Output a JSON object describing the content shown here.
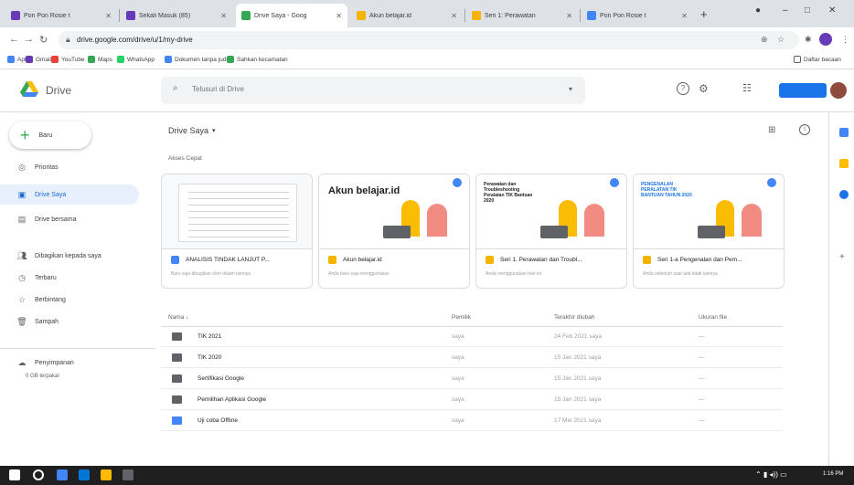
{
  "browser": {
    "tabs": [
      {
        "label": "Pon Pon Rosie t",
        "active": false,
        "color": "#673ab7"
      },
      {
        "label": "Sekali Masuk (85)",
        "active": false,
        "color": "#673ab7"
      },
      {
        "label": "Drive Saya - Goog",
        "active": true,
        "color": "#34a853"
      },
      {
        "label": "Akun belajar.id",
        "active": false,
        "color": "#f4b400"
      },
      {
        "label": "Seri 1: Perawatan",
        "active": false,
        "color": "#f4b400"
      },
      {
        "label": "Pon Pon Rosie t",
        "active": false,
        "color": "#4285f4"
      }
    ],
    "new_tab_label": "+",
    "url": "drive.google.com/drive/u/1/my-drive",
    "bookmarks": [
      {
        "label": "Apl",
        "color": "#4285f4"
      },
      {
        "label": "Gmail",
        "color": "#673ab7"
      },
      {
        "label": "YouTube",
        "color": "#ea4335"
      },
      {
        "label": "Maps",
        "color": "#34a853"
      },
      {
        "label": "WhatsApp",
        "color": "#25d366"
      },
      {
        "label": "Dokumen tanpa judul",
        "color": "#4285f4"
      },
      {
        "label": "Sahkan kecamatan",
        "color": "#34a853"
      }
    ],
    "reading_list_label": "Daftar bacaan"
  },
  "drive": {
    "app_name": "Drive",
    "search_placeholder": "Telusuri di Drive",
    "new_button": "Baru",
    "sidebar": [
      {
        "label": "Prioritas",
        "icon": "check-circle-icon"
      },
      {
        "label": "Drive Saya",
        "icon": "my-drive-icon",
        "active": true
      },
      {
        "label": "Drive bersama",
        "icon": "shared-drive-icon"
      },
      {
        "label": "Dibagikan kepada saya",
        "icon": "people-icon"
      },
      {
        "label": "Terbaru",
        "icon": "clock-icon"
      },
      {
        "label": "Berbintang",
        "icon": "star-icon"
      },
      {
        "label": "Sampah",
        "icon": "trash-icon"
      }
    ],
    "storage_label": "Penyimpanan",
    "storage_used": "0 GB terpakai",
    "breadcrumb": "Drive Saya",
    "quick_access_label": "Akses Cepat",
    "cards": [
      {
        "title": "ANALISIS TINDAK LANJUT P...",
        "subtitle": "Baru saja dibagikan oleh dalam lainnya",
        "icon_color": "#4285f4",
        "thumb": "doc"
      },
      {
        "title": "Akun belajar.id",
        "subtitle": "Anda baru saja menggunakan",
        "icon_color": "#f4b400",
        "thumb": "akun",
        "thumb_text": "Akun belajar.id"
      },
      {
        "title": "Seri 1. Perawatan dan Troubl...",
        "subtitle": "Anda menggunakan hari ini",
        "icon_color": "#f4b400",
        "thumb": "seri1",
        "thumb_text": "Perawatan dan Troubleshooting Peralatan TIK Bantuan 2020"
      },
      {
        "title": "Seri 1-a Pengenalan dan Pem...",
        "subtitle": "Anda sebelum saat ada tidak lainnya",
        "icon_color": "#f4b400",
        "thumb": "seri1a",
        "thumb_text": "PENGENALAN PERALATAN TIK BANTUAN TAHUN 2020"
      }
    ],
    "table": {
      "headers": {
        "name": "Nama",
        "owner": "Pemilik",
        "modified": "Terakhir diubah",
        "size": "Ukuran file"
      },
      "rows": [
        {
          "name": "TIK 2021",
          "owner": "saya",
          "modified": "24 Feb 2021 saya",
          "size": "—",
          "type": "folder"
        },
        {
          "name": "TIK 2020",
          "owner": "saya",
          "modified": "15 Jan 2021 saya",
          "size": "—",
          "type": "folder"
        },
        {
          "name": "Sertifikasi Google",
          "owner": "saya",
          "modified": "15 Jan 2021 saya",
          "size": "—",
          "type": "folder"
        },
        {
          "name": "Pemilihan Aplikasi Google",
          "owner": "saya",
          "modified": "15 Jan 2021 saya",
          "size": "—",
          "type": "folder"
        },
        {
          "name": "Uji coba Offline",
          "owner": "saya",
          "modified": "17 Mei 2021 saya",
          "size": "—",
          "type": "doc"
        }
      ]
    }
  },
  "taskbar": {
    "clock": "1:16 PM"
  },
  "colors": {
    "accent": "#1a73e8",
    "drive_green": "#34a853",
    "folder": "#5f6368"
  }
}
